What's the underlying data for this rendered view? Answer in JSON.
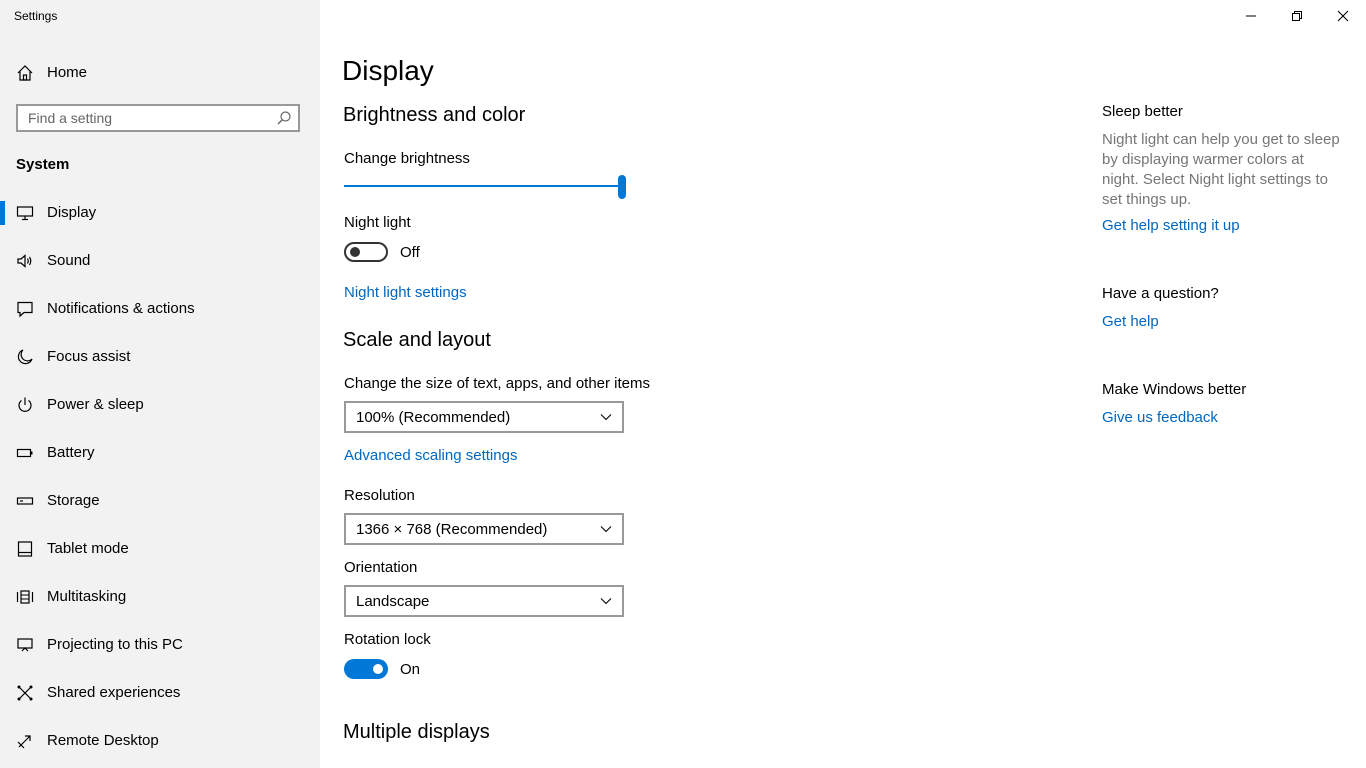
{
  "window": {
    "title": "Settings"
  },
  "sidebar": {
    "home_label": "Home",
    "search_placeholder": "Find a setting",
    "section_title": "System",
    "items": [
      {
        "label": "Display",
        "icon": "monitor-icon",
        "active": true
      },
      {
        "label": "Sound",
        "icon": "speaker-icon"
      },
      {
        "label": "Notifications & actions",
        "icon": "message-icon"
      },
      {
        "label": "Focus assist",
        "icon": "moon-icon"
      },
      {
        "label": "Power & sleep",
        "icon": "power-icon"
      },
      {
        "label": "Battery",
        "icon": "battery-icon"
      },
      {
        "label": "Storage",
        "icon": "storage-icon"
      },
      {
        "label": "Tablet mode",
        "icon": "tablet-icon"
      },
      {
        "label": "Multitasking",
        "icon": "multitasking-icon"
      },
      {
        "label": "Projecting to this PC",
        "icon": "projector-icon"
      },
      {
        "label": "Shared experiences",
        "icon": "shared-icon"
      },
      {
        "label": "Remote Desktop",
        "icon": "remote-desktop-icon"
      }
    ]
  },
  "main": {
    "title": "Display",
    "brightness": {
      "heading": "Brightness and color",
      "brightness_label": "Change brightness",
      "brightness_value": 100,
      "night_light_label": "Night light",
      "night_light_state": "Off",
      "night_light_link": "Night light settings"
    },
    "scale": {
      "heading": "Scale and layout",
      "size_label": "Change the size of text, apps, and other items",
      "size_value": "100% (Recommended)",
      "advanced_link": "Advanced scaling settings",
      "resolution_label": "Resolution",
      "resolution_value": "1366 × 768 (Recommended)",
      "orientation_label": "Orientation",
      "orientation_value": "Landscape",
      "rotation_lock_label": "Rotation lock",
      "rotation_lock_state": "On"
    },
    "multiple_displays_heading": "Multiple displays"
  },
  "aside": {
    "sleep_heading": "Sleep better",
    "sleep_text": "Night light can help you get to sleep by displaying warmer colors at night. Select Night light settings to set things up.",
    "sleep_link": "Get help setting it up",
    "question_heading": "Have a question?",
    "question_link": "Get help",
    "better_heading": "Make Windows better",
    "better_link": "Give us feedback"
  },
  "colors": {
    "accent": "#0078d7",
    "link": "#0067c0",
    "sidebar_bg": "#f2f2f2"
  }
}
